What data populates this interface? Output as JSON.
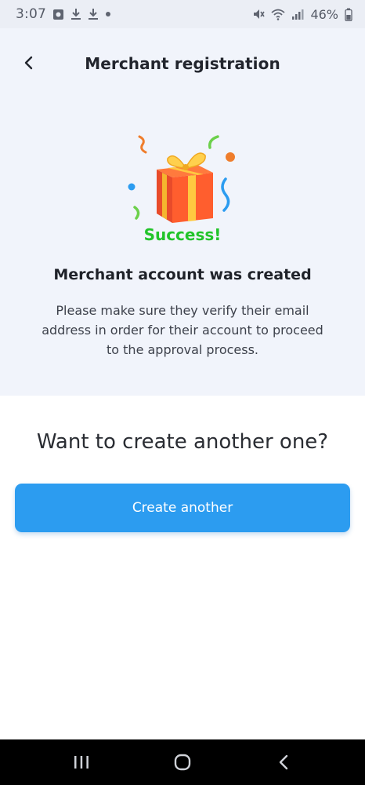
{
  "status_bar": {
    "time": "3:07",
    "battery": "46%",
    "icons": [
      "notification-app-icon",
      "download-icon",
      "download-icon",
      "dot-icon",
      "mute-icon",
      "wifi-icon",
      "signal-icon",
      "battery-icon"
    ]
  },
  "header": {
    "title": "Merchant registration",
    "back_icon": "chevron-left-icon"
  },
  "illustration": {
    "icon": "gift-box-icon",
    "label": "Success!",
    "label_color": "#22c42a"
  },
  "result": {
    "title": "Merchant account was created",
    "description": "Please make sure they verify their email address in order for their account to proceed to the approval process."
  },
  "cta": {
    "question": "Want to create another one?",
    "button_label": "Create another"
  },
  "nav_bar": {
    "icons": [
      "recent-apps-icon",
      "home-icon",
      "back-icon"
    ]
  },
  "colors": {
    "accent": "#2c9cf0",
    "top_background": "#f1f4fb",
    "success": "#22c42a"
  }
}
